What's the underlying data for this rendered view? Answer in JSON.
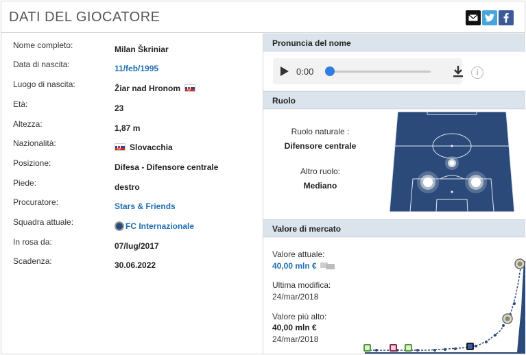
{
  "header": {
    "title": "DATI DEL GIOCATORE"
  },
  "share": {
    "mail_icon": "mail-icon",
    "twitter_icon": "twitter-icon",
    "facebook_icon": "facebook-icon"
  },
  "details": [
    {
      "label": "Nome completo:",
      "value": "Milan Škriniar",
      "style": "bold"
    },
    {
      "label": "Data di nascita:",
      "value": "11/feb/1995",
      "style": "link"
    },
    {
      "label": "Luogo di nascita:",
      "value": "Žiar nad Hronom",
      "style": "bold",
      "flag_after": true
    },
    {
      "label": "Età:",
      "value": "23",
      "style": "bold"
    },
    {
      "label": "Altezza:",
      "value": "1,87 m",
      "style": "bold"
    },
    {
      "label": "Nazionalità:",
      "value": "Slovacchia",
      "style": "bold",
      "flag_before": true
    },
    {
      "label": "Posizione:",
      "value": "Difesa - Difensore centrale",
      "style": "bold"
    },
    {
      "label": "Piede:",
      "value": "destro",
      "style": "bold"
    },
    {
      "label": "Procuratore:",
      "value": "Stars & Friends",
      "style": "link"
    },
    {
      "label": "Squadra attuale:",
      "value": "FC Internazionale",
      "style": "link",
      "club_icon": true
    },
    {
      "label": "In rosa da:",
      "value": "07/lug/2017",
      "style": "bold"
    },
    {
      "label": "Scadenza:",
      "value": "30.06.2022",
      "style": "bold"
    }
  ],
  "pronunciation": {
    "heading": "Pronuncia del nome",
    "time": "0:00",
    "progress": 0
  },
  "role": {
    "heading": "Ruolo",
    "natural_label": "Ruolo naturale :",
    "natural_value": "Difensore centrale",
    "other_label": "Altro ruolo:",
    "other_value": "Mediano"
  },
  "market": {
    "heading": "Valore di mercato",
    "current_label": "Valore attuale:",
    "current_value": "40,00 mln €",
    "last_change_label": "Ultima modifica:",
    "last_change_date": "24/mar/2018",
    "highest_label": "Valore più alto:",
    "highest_value": "40,00 mln €",
    "highest_date": "24/mar/2018"
  },
  "colors": {
    "link": "#1e6eb4",
    "section_header": "#dbe4ec",
    "pitch": "#2b4a7a",
    "chart_fill": "#2b4a7a",
    "accent_blue": "#2f7de1"
  }
}
